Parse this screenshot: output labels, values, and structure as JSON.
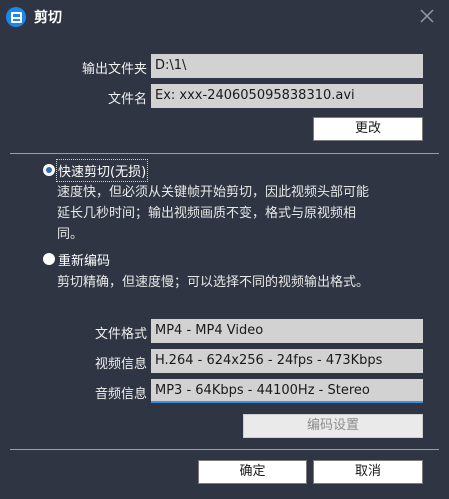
{
  "window": {
    "title": "剪切"
  },
  "output": {
    "folder_label": "输出文件夹",
    "folder_value": "D:\\1\\",
    "filename_label": "文件名",
    "filename_value": "Ex: xxx-240605095838310.avi",
    "change_button": "更改"
  },
  "modes": {
    "fast": {
      "label": "快速剪切(无损)",
      "checked": true,
      "desc_line1": "速度快，但必须从关键帧开始剪切，因此视频头部可能",
      "desc_line2": "延长几秒时间；输出视频画质不变，格式与原视频相",
      "desc_line3": "同。"
    },
    "reencode": {
      "label": "重新编码",
      "checked": false,
      "desc": "剪切精确，但速度慢；可以选择不同的视频输出格式。"
    }
  },
  "format": {
    "format_label": "文件格式",
    "format_value": "MP4 - MP4 Video",
    "video_label": "视频信息",
    "video_value": "H.264 - 624x256 - 24fps - 473Kbps",
    "audio_label": "音频信息",
    "audio_value": "MP3 - 64Kbps - 44100Hz - Stereo",
    "encode_settings_button": "编码设置"
  },
  "footer": {
    "ok_button": "确定",
    "cancel_button": "取消"
  },
  "colors": {
    "background": "#2f3542",
    "accent": "#1e86e8",
    "field": "#d2d2d2"
  }
}
